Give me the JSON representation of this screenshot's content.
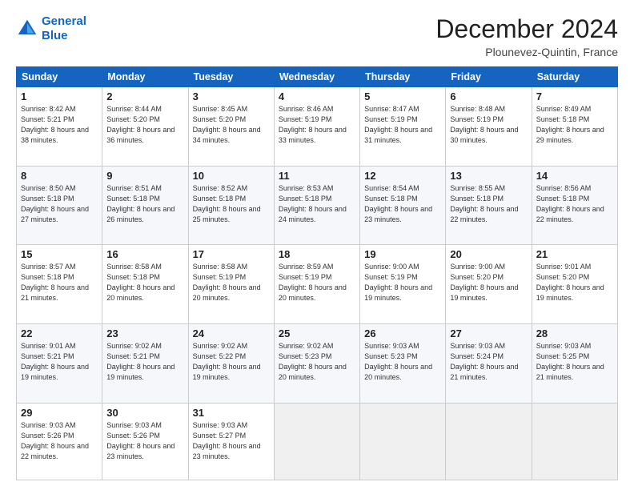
{
  "header": {
    "logo_line1": "General",
    "logo_line2": "Blue",
    "title": "December 2024",
    "subtitle": "Plounevez-Quintin, France"
  },
  "weekdays": [
    "Sunday",
    "Monday",
    "Tuesday",
    "Wednesday",
    "Thursday",
    "Friday",
    "Saturday"
  ],
  "weeks": [
    [
      {
        "day": "1",
        "sunrise": "Sunrise: 8:42 AM",
        "sunset": "Sunset: 5:21 PM",
        "daylight": "Daylight: 8 hours and 38 minutes."
      },
      {
        "day": "2",
        "sunrise": "Sunrise: 8:44 AM",
        "sunset": "Sunset: 5:20 PM",
        "daylight": "Daylight: 8 hours and 36 minutes."
      },
      {
        "day": "3",
        "sunrise": "Sunrise: 8:45 AM",
        "sunset": "Sunset: 5:20 PM",
        "daylight": "Daylight: 8 hours and 34 minutes."
      },
      {
        "day": "4",
        "sunrise": "Sunrise: 8:46 AM",
        "sunset": "Sunset: 5:19 PM",
        "daylight": "Daylight: 8 hours and 33 minutes."
      },
      {
        "day": "5",
        "sunrise": "Sunrise: 8:47 AM",
        "sunset": "Sunset: 5:19 PM",
        "daylight": "Daylight: 8 hours and 31 minutes."
      },
      {
        "day": "6",
        "sunrise": "Sunrise: 8:48 AM",
        "sunset": "Sunset: 5:19 PM",
        "daylight": "Daylight: 8 hours and 30 minutes."
      },
      {
        "day": "7",
        "sunrise": "Sunrise: 8:49 AM",
        "sunset": "Sunset: 5:18 PM",
        "daylight": "Daylight: 8 hours and 29 minutes."
      }
    ],
    [
      {
        "day": "8",
        "sunrise": "Sunrise: 8:50 AM",
        "sunset": "Sunset: 5:18 PM",
        "daylight": "Daylight: 8 hours and 27 minutes."
      },
      {
        "day": "9",
        "sunrise": "Sunrise: 8:51 AM",
        "sunset": "Sunset: 5:18 PM",
        "daylight": "Daylight: 8 hours and 26 minutes."
      },
      {
        "day": "10",
        "sunrise": "Sunrise: 8:52 AM",
        "sunset": "Sunset: 5:18 PM",
        "daylight": "Daylight: 8 hours and 25 minutes."
      },
      {
        "day": "11",
        "sunrise": "Sunrise: 8:53 AM",
        "sunset": "Sunset: 5:18 PM",
        "daylight": "Daylight: 8 hours and 24 minutes."
      },
      {
        "day": "12",
        "sunrise": "Sunrise: 8:54 AM",
        "sunset": "Sunset: 5:18 PM",
        "daylight": "Daylight: 8 hours and 23 minutes."
      },
      {
        "day": "13",
        "sunrise": "Sunrise: 8:55 AM",
        "sunset": "Sunset: 5:18 PM",
        "daylight": "Daylight: 8 hours and 22 minutes."
      },
      {
        "day": "14",
        "sunrise": "Sunrise: 8:56 AM",
        "sunset": "Sunset: 5:18 PM",
        "daylight": "Daylight: 8 hours and 22 minutes."
      }
    ],
    [
      {
        "day": "15",
        "sunrise": "Sunrise: 8:57 AM",
        "sunset": "Sunset: 5:18 PM",
        "daylight": "Daylight: 8 hours and 21 minutes."
      },
      {
        "day": "16",
        "sunrise": "Sunrise: 8:58 AM",
        "sunset": "Sunset: 5:18 PM",
        "daylight": "Daylight: 8 hours and 20 minutes."
      },
      {
        "day": "17",
        "sunrise": "Sunrise: 8:58 AM",
        "sunset": "Sunset: 5:19 PM",
        "daylight": "Daylight: 8 hours and 20 minutes."
      },
      {
        "day": "18",
        "sunrise": "Sunrise: 8:59 AM",
        "sunset": "Sunset: 5:19 PM",
        "daylight": "Daylight: 8 hours and 20 minutes."
      },
      {
        "day": "19",
        "sunrise": "Sunrise: 9:00 AM",
        "sunset": "Sunset: 5:19 PM",
        "daylight": "Daylight: 8 hours and 19 minutes."
      },
      {
        "day": "20",
        "sunrise": "Sunrise: 9:00 AM",
        "sunset": "Sunset: 5:20 PM",
        "daylight": "Daylight: 8 hours and 19 minutes."
      },
      {
        "day": "21",
        "sunrise": "Sunrise: 9:01 AM",
        "sunset": "Sunset: 5:20 PM",
        "daylight": "Daylight: 8 hours and 19 minutes."
      }
    ],
    [
      {
        "day": "22",
        "sunrise": "Sunrise: 9:01 AM",
        "sunset": "Sunset: 5:21 PM",
        "daylight": "Daylight: 8 hours and 19 minutes."
      },
      {
        "day": "23",
        "sunrise": "Sunrise: 9:02 AM",
        "sunset": "Sunset: 5:21 PM",
        "daylight": "Daylight: 8 hours and 19 minutes."
      },
      {
        "day": "24",
        "sunrise": "Sunrise: 9:02 AM",
        "sunset": "Sunset: 5:22 PM",
        "daylight": "Daylight: 8 hours and 19 minutes."
      },
      {
        "day": "25",
        "sunrise": "Sunrise: 9:02 AM",
        "sunset": "Sunset: 5:23 PM",
        "daylight": "Daylight: 8 hours and 20 minutes."
      },
      {
        "day": "26",
        "sunrise": "Sunrise: 9:03 AM",
        "sunset": "Sunset: 5:23 PM",
        "daylight": "Daylight: 8 hours and 20 minutes."
      },
      {
        "day": "27",
        "sunrise": "Sunrise: 9:03 AM",
        "sunset": "Sunset: 5:24 PM",
        "daylight": "Daylight: 8 hours and 21 minutes."
      },
      {
        "day": "28",
        "sunrise": "Sunrise: 9:03 AM",
        "sunset": "Sunset: 5:25 PM",
        "daylight": "Daylight: 8 hours and 21 minutes."
      }
    ],
    [
      {
        "day": "29",
        "sunrise": "Sunrise: 9:03 AM",
        "sunset": "Sunset: 5:26 PM",
        "daylight": "Daylight: 8 hours and 22 minutes."
      },
      {
        "day": "30",
        "sunrise": "Sunrise: 9:03 AM",
        "sunset": "Sunset: 5:26 PM",
        "daylight": "Daylight: 8 hours and 23 minutes."
      },
      {
        "day": "31",
        "sunrise": "Sunrise: 9:03 AM",
        "sunset": "Sunset: 5:27 PM",
        "daylight": "Daylight: 8 hours and 23 minutes."
      },
      null,
      null,
      null,
      null
    ]
  ]
}
